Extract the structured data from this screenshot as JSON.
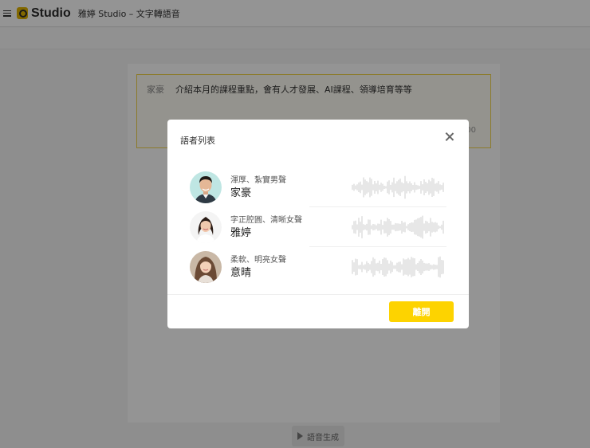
{
  "header": {
    "logo_text": "Studio",
    "app_title": "雅婷 Studio – 文字轉語音"
  },
  "editor": {
    "speaker_label": "家豪",
    "script_text": "介紹本月的課程重點，會有人才發展、AI課程、領導培育等等",
    "char_count": "00",
    "generate_button": "語音生成"
  },
  "modal": {
    "title": "語者列表",
    "voices": [
      {
        "description": "渾厚、紮實男聲",
        "name": "家豪",
        "avatar": "male-avatar"
      },
      {
        "description": "字正腔圓、清晰女聲",
        "name": "雅婷",
        "avatar": "female-avatar"
      },
      {
        "description": "柔軟、明亮女聲",
        "name": "意晴",
        "avatar": "female-avatar"
      }
    ],
    "close_button": "離開"
  },
  "colors": {
    "accent": "#fdd300",
    "logo": "#e0b400",
    "input_border": "#f1d54a",
    "overlay": "rgba(0,0,0,0.42)"
  }
}
